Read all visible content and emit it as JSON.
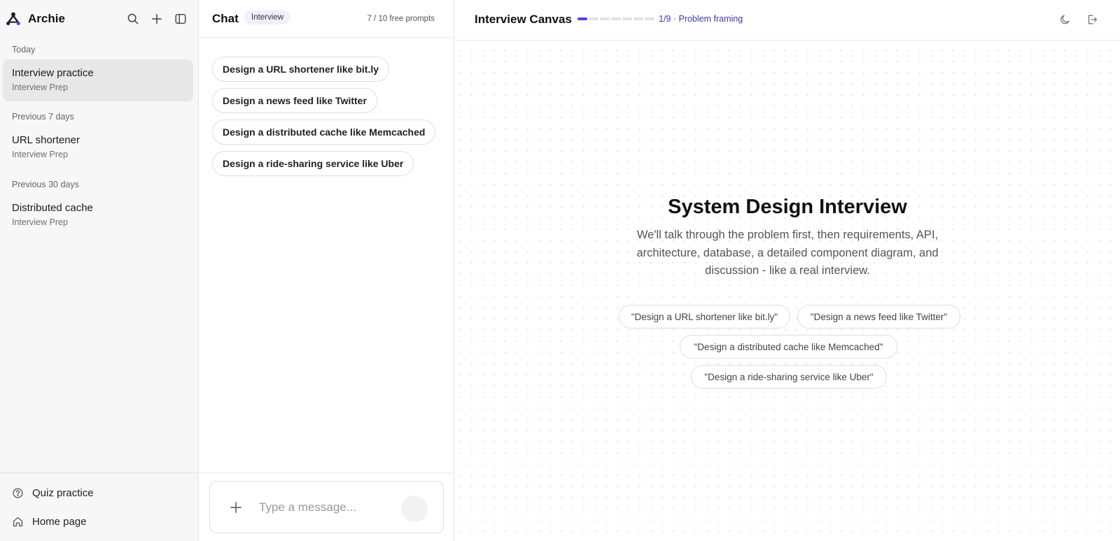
{
  "sidebar": {
    "brand": "Archie",
    "groups": [
      {
        "label": "Today",
        "items": [
          {
            "title": "Interview practice",
            "subtitle": "Interview Prep"
          }
        ]
      },
      {
        "label": "Previous 7 days",
        "items": [
          {
            "title": "URL shortener",
            "subtitle": "Interview Prep"
          }
        ]
      },
      {
        "label": "Previous 30 days",
        "items": [
          {
            "title": "Distributed cache",
            "subtitle": "Interview Prep"
          }
        ]
      }
    ],
    "footer": {
      "quiz": "Quiz practice",
      "home": "Home page"
    }
  },
  "chat": {
    "title": "Chat",
    "badge": "Interview",
    "quota": "7 / 10 free prompts",
    "suggestions": [
      "Design a URL shortener like bit.ly",
      "Design a news feed like Twitter",
      "Design a distributed cache like Memcached",
      "Design a ride-sharing service like Uber"
    ],
    "composer": {
      "placeholder": "Type a message..."
    }
  },
  "canvas": {
    "title": "Interview Canvas",
    "progress": {
      "current": 1,
      "total": 9
    },
    "step_label": "1/9 · Problem framing",
    "hero_title": "System Design Interview",
    "hero_desc": "We'll talk through the problem first, then requirements, API, architecture, database, a detailed component diagram, and discussion - like a real interview.",
    "chips": [
      "\"Design a URL shortener like bit.ly\"",
      "\"Design a news feed like Twitter\"",
      "\"Design a distributed cache like Memcached\"",
      "\"Design a ride-sharing service like Uber\""
    ]
  },
  "colors": {
    "accent": "#4f46e5",
    "badge_bg": "#eef0fb",
    "sidebar_bg": "#f7f7f7"
  }
}
